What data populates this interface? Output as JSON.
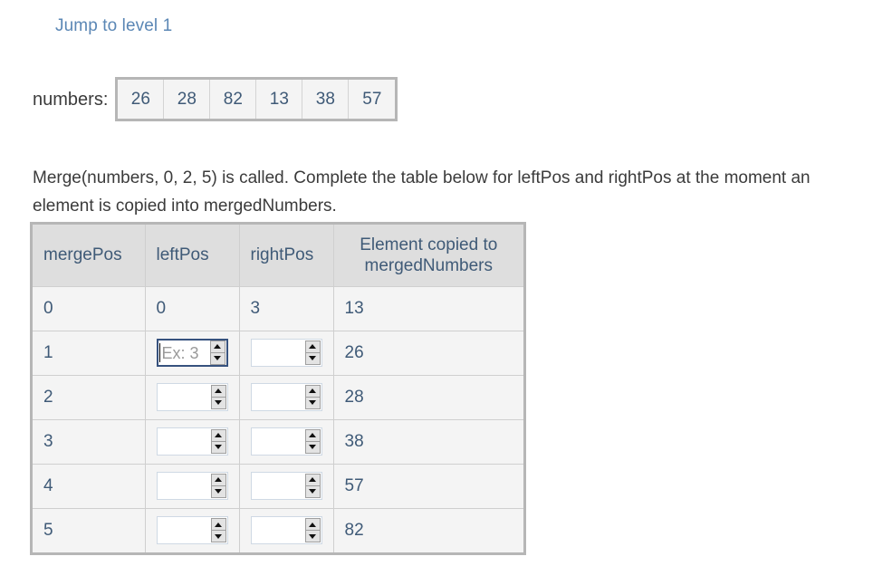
{
  "jump_link": {
    "label": "Jump to level 1",
    "color": "#5b87b5"
  },
  "numbers": {
    "label": "numbers:",
    "values": [
      "26",
      "28",
      "82",
      "13",
      "38",
      "57"
    ]
  },
  "prompt": {
    "text": "Merge(numbers, 0, 2, 5) is called. Complete the table below for leftPos and rightPos at the moment an element is copied into mergedNumbers."
  },
  "table": {
    "headers": {
      "merge_pos": "mergePos",
      "left_pos": "leftPos",
      "right_pos": "rightPos",
      "element_line1": "Element copied to",
      "element_line2": "mergedNumbers"
    },
    "rows": [
      {
        "merge_pos": "0",
        "left_pos": {
          "type": "text",
          "value": "0"
        },
        "right_pos": {
          "type": "text",
          "value": "3"
        },
        "element": "13"
      },
      {
        "merge_pos": "1",
        "left_pos": {
          "type": "input",
          "value": "",
          "placeholder": "Ex: 3",
          "focused": true
        },
        "right_pos": {
          "type": "input",
          "value": "",
          "placeholder": "",
          "focused": false
        },
        "element": "26"
      },
      {
        "merge_pos": "2",
        "left_pos": {
          "type": "input",
          "value": "",
          "placeholder": "",
          "focused": false
        },
        "right_pos": {
          "type": "input",
          "value": "",
          "placeholder": "",
          "focused": false
        },
        "element": "28"
      },
      {
        "merge_pos": "3",
        "left_pos": {
          "type": "input",
          "value": "",
          "placeholder": "",
          "focused": false
        },
        "right_pos": {
          "type": "input",
          "value": "",
          "placeholder": "",
          "focused": false
        },
        "element": "38"
      },
      {
        "merge_pos": "4",
        "left_pos": {
          "type": "input",
          "value": "",
          "placeholder": "",
          "focused": false
        },
        "right_pos": {
          "type": "input",
          "value": "",
          "placeholder": "",
          "focused": false
        },
        "element": "57"
      },
      {
        "merge_pos": "5",
        "left_pos": {
          "type": "input",
          "value": "",
          "placeholder": "",
          "focused": false
        },
        "right_pos": {
          "type": "input",
          "value": "",
          "placeholder": "",
          "focused": false
        },
        "element": "82"
      }
    ]
  },
  "colors": {
    "link": "#5b87b5",
    "cell_text": "#3f5a77",
    "body_text": "#3b3b3b",
    "table_border": "#b6b6b6",
    "header_bg": "#dedede",
    "row_bg": "#f4f4f4",
    "focus_border": "#36527e"
  }
}
